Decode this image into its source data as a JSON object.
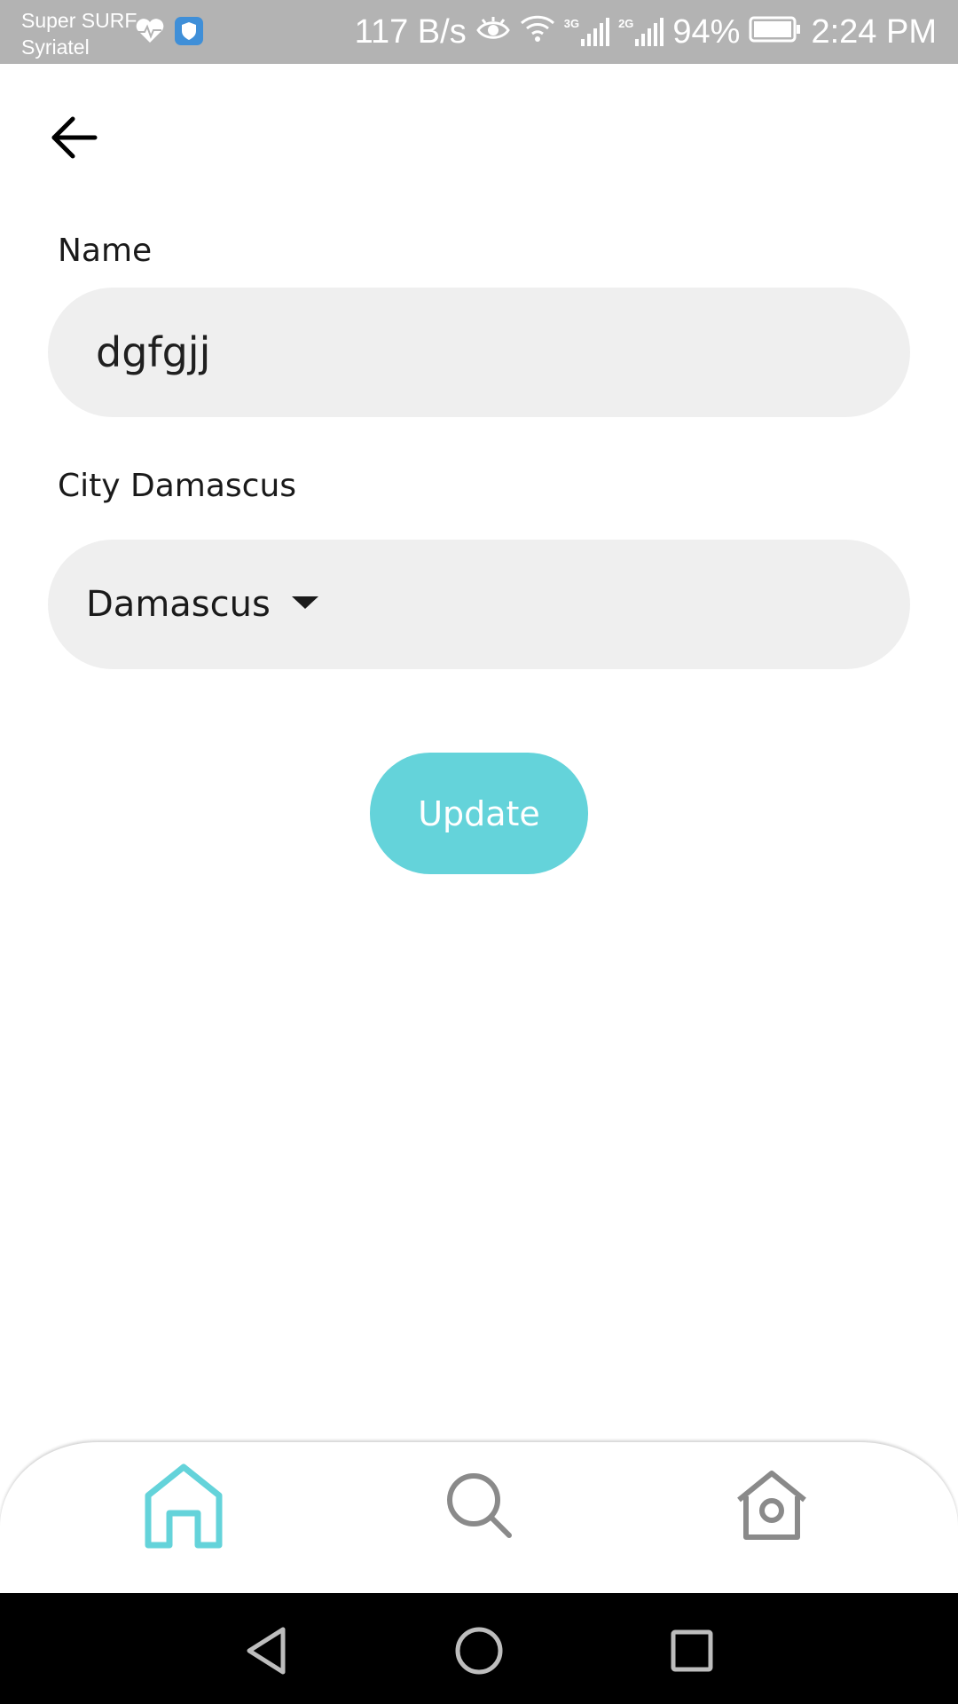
{
  "status_bar": {
    "carrier_line1": "Super SURF",
    "carrier_line2": "Syriatel",
    "net_speed": "117 B/s",
    "net_3g": "3G",
    "net_2g": "2G",
    "battery": "94%",
    "time": "2:24 PM",
    "icons": [
      "health-icon",
      "shield-icon",
      "eye-icon",
      "wifi-icon",
      "signal-icon",
      "signal-icon",
      "battery-icon"
    ]
  },
  "header": {
    "back_icon": "arrow-left-icon"
  },
  "form": {
    "name_label": "Name",
    "name_value": "dgfgjj",
    "city_label": "City Damascus",
    "city_selected": "Damascus",
    "update_label": "Update"
  },
  "bottom_nav": {
    "items": [
      {
        "icon": "home-icon",
        "active": true
      },
      {
        "icon": "search-icon",
        "active": false
      },
      {
        "icon": "house-camera-icon",
        "active": false
      }
    ]
  },
  "colors": {
    "accent": "#64d3da",
    "field_bg": "#efefef",
    "status_bar": "#b3b3b3",
    "nav_inactive": "#8a8a8a"
  }
}
